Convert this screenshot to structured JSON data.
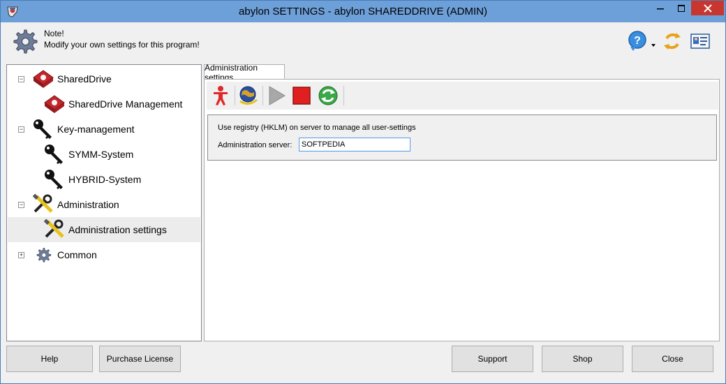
{
  "window": {
    "title": "abylon SETTINGS - abylon SHAREDDRIVE (ADMIN)"
  },
  "note": {
    "title": "Note!",
    "text": "Modify your own settings for this program!"
  },
  "tree": {
    "items": [
      {
        "label": "SharedDrive",
        "level": 0,
        "expander": "−",
        "icon": "shareddrive-icon"
      },
      {
        "label": "SharedDrive Management",
        "level": 1,
        "icon": "shareddrive-icon"
      },
      {
        "label": "Key-management",
        "level": 0,
        "expander": "−",
        "icon": "key-icon"
      },
      {
        "label": "SYMM-System",
        "level": 1,
        "icon": "key-icon"
      },
      {
        "label": "HYBRID-System",
        "level": 1,
        "icon": "key-icon"
      },
      {
        "label": "Administration",
        "level": 0,
        "expander": "−",
        "icon": "tools-icon"
      },
      {
        "label": "Administration settings",
        "level": 1,
        "icon": "tools-icon",
        "selected": true
      },
      {
        "label": "Common",
        "level": 0,
        "expander": "+",
        "icon": "gear-icon"
      }
    ]
  },
  "tab": {
    "label": "Administration settings"
  },
  "settings": {
    "hint": "Use registry (HKLM) on server to manage all user-settings",
    "server_label": "Administration server:",
    "server_value": "SOFTPEDIA"
  },
  "buttons": {
    "help": "Help",
    "purchase": "Purchase License",
    "support": "Support",
    "shop": "Shop",
    "close": "Close"
  },
  "colors": {
    "titlebar": "#6d9fd8",
    "close_button": "#c7372f",
    "selection": "#ececec"
  }
}
